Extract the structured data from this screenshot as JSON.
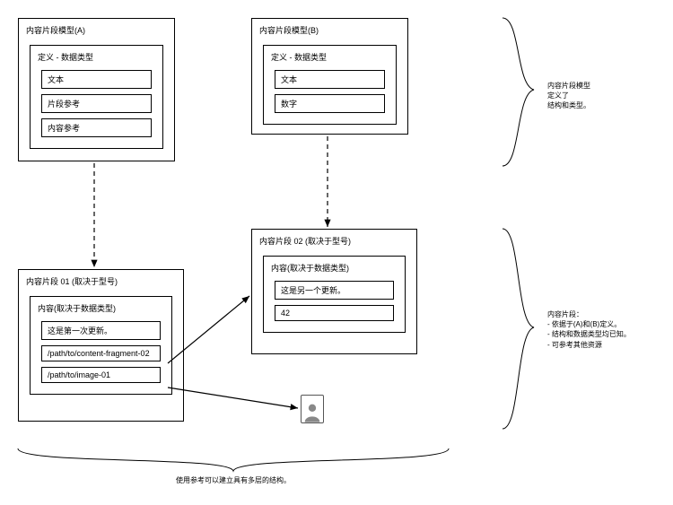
{
  "modelA": {
    "title": "内容片段模型(A)",
    "defTitle": "定义 - 数据类型",
    "fields": [
      "文本",
      "片段参考",
      "内容参考"
    ]
  },
  "modelB": {
    "title": "内容片段模型(B)",
    "defTitle": "定义 - 数据类型",
    "fields": [
      "文本",
      "数字"
    ]
  },
  "frag01": {
    "title": "内容片段 01 (取决于型号)",
    "contentTitle": "内容(取决于数据类型)",
    "values": [
      "这是第一次更新。",
      "/path/to/content-fragment-02",
      "/path/to/image-01"
    ]
  },
  "frag02": {
    "title": "内容片段 02 (取决于型号)",
    "contentTitle": "内容(取决于数据类型)",
    "values": [
      "这是另一个更新。",
      "42"
    ]
  },
  "topAnnotation": {
    "line1": "内容片段模型",
    "line2": "定义了",
    "line3": "结构和类型。"
  },
  "bottomAnnotation": {
    "title": "内容片段：",
    "b1": "- 依据于(A)和(B)定义。",
    "b2": "- 结构和数据类型均已知。",
    "b3": "- 可参考其他资源"
  },
  "bottomCaption": "使用参考可以建立具有多层的结构。"
}
